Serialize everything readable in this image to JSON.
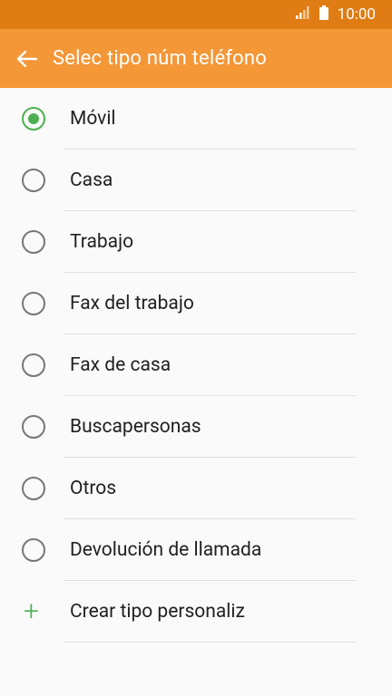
{
  "status_bar": {
    "time": "10:00"
  },
  "app_bar": {
    "title": "Selec tipo núm teléfono"
  },
  "options": [
    {
      "label": "Móvil",
      "checked": true
    },
    {
      "label": "Casa",
      "checked": false
    },
    {
      "label": "Trabajo",
      "checked": false
    },
    {
      "label": "Fax del trabajo",
      "checked": false
    },
    {
      "label": "Fax de casa",
      "checked": false
    },
    {
      "label": "Buscapersonas",
      "checked": false
    },
    {
      "label": "Otros",
      "checked": false
    },
    {
      "label": "Devolución de llamada",
      "checked": false
    }
  ],
  "custom_type": {
    "label": "Crear tipo personaliz"
  },
  "colors": {
    "status_bar": "#e07c14",
    "app_bar": "#f39737",
    "accent": "#4cb050"
  }
}
